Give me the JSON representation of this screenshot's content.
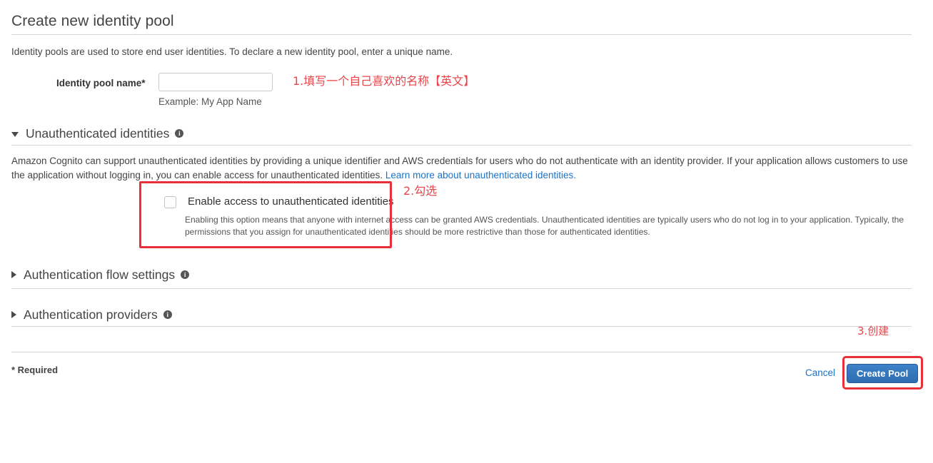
{
  "page": {
    "title": "Create new identity pool",
    "intro": "Identity pools are used to store end user identities. To declare a new identity pool, enter a unique name."
  },
  "form": {
    "name_label": "Identity pool name*",
    "name_value": "",
    "name_placeholder": "",
    "name_hint": "Example: My App Name"
  },
  "sections": {
    "unauthenticated": {
      "title": "Unauthenticated identities",
      "expanded": true,
      "triangle": "triangle-down-icon",
      "info_icon": "info-icon",
      "body_part1": "Amazon Cognito can support unauthenticated identities by providing a unique identifier and AWS credentials for users who do not authenticate with an identity provider. If your application allows customers to use the application without logging in, you can enable access for unauthenticated identities. ",
      "link_text": "Learn more about unauthenticated identities.",
      "checkbox_label": "Enable access to unauthenticated identities",
      "checkbox_checked": false,
      "checkbox_help": "Enabling this option means that anyone with internet access can be granted AWS credentials. Unauthenticated identities are typically users who do not log in to your application. Typically, the permissions that you assign for unauthenticated identities should be more restrictive than those for authenticated identities."
    },
    "auth_flow": {
      "title": "Authentication flow settings",
      "expanded": false,
      "triangle": "triangle-right-icon",
      "info_icon": "info-icon"
    },
    "auth_providers": {
      "title": "Authentication providers",
      "expanded": false,
      "triangle": "triangle-right-icon",
      "info_icon": "info-icon"
    }
  },
  "footer": {
    "required_note": "* Required",
    "cancel_label": "Cancel",
    "create_label": "Create Pool"
  },
  "annotations": {
    "step1": "1.填写一个自己喜欢的名称【英文】",
    "step2": "2.勾选",
    "step3": "3.创建",
    "color": "#e8454a",
    "box_color": "#e8303a"
  },
  "colors": {
    "link": "#1a73c8",
    "button_blue": "#2f6cb0",
    "text": "#333333",
    "divider": "#d5d5d5"
  }
}
